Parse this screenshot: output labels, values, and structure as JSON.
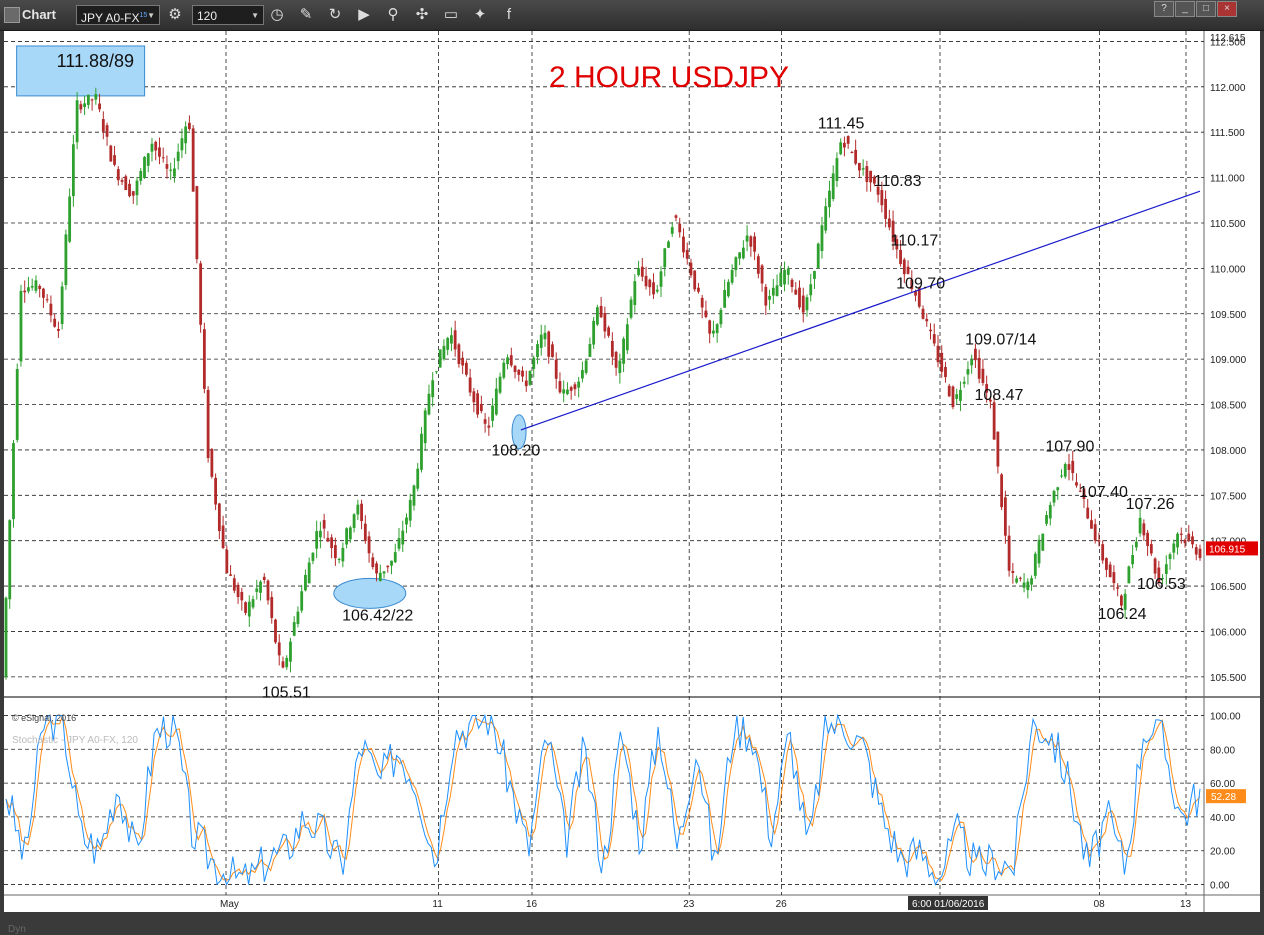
{
  "toolbar": {
    "app_title": "Chart",
    "symbol": "JPY A0-FX",
    "symbol_sup": "15",
    "interval": "120",
    "window_buttons": [
      "?",
      "_",
      "□",
      "×"
    ]
  },
  "copyright": "© eSignal, 2016",
  "stoch_label": "Stochastic - JPY A0-FX, 120",
  "dyn_label": "Dyn",
  "colors": {
    "up": "#2ea02e",
    "down": "#b22a2a",
    "title": "#e00000",
    "trend": "#1a1acc",
    "k": "#1e90ff",
    "d": "#ff8c1a",
    "price_badge": "#e00000",
    "stoch_badge": "#ff8c1a",
    "highlight": "#a8d8f8"
  },
  "chart_data": [
    {
      "type": "candlestick",
      "title": "2 HOUR USDJPY",
      "ylim": [
        105.3,
        112.615
      ],
      "yticks": [
        105.5,
        106.0,
        106.5,
        107.0,
        107.5,
        108.0,
        108.5,
        109.0,
        109.5,
        110.0,
        110.5,
        111.0,
        111.5,
        112.0,
        112.5
      ],
      "ytick_labels": [
        "105.500",
        "106.000",
        "106.500",
        "107.000",
        "107.500",
        "108.000",
        "108.500",
        "109.000",
        "109.500",
        "110.000",
        "110.500",
        "111.000",
        "111.500",
        "112.000",
        "112.500"
      ],
      "top_label": "112.615",
      "last_price": "106.915",
      "x_labels": [
        "May",
        "11",
        "16",
        "23",
        "26",
        "6:00 01/06/2016",
        "08",
        "13"
      ],
      "path_points": [
        105.5,
        109.8,
        109.8,
        109.3,
        111.8,
        111.88,
        111.1,
        110.8,
        111.4,
        111.0,
        111.7,
        108.0,
        106.7,
        106.2,
        106.6,
        105.51,
        106.4,
        107.2,
        106.8,
        107.4,
        106.6,
        106.8,
        107.5,
        108.8,
        109.3,
        108.7,
        108.2,
        109.1,
        108.7,
        109.3,
        108.6,
        108.8,
        109.6,
        108.8,
        110.0,
        109.7,
        110.6,
        109.9,
        109.2,
        109.9,
        110.4,
        109.6,
        110.0,
        109.5,
        110.5,
        111.45,
        111.1,
        110.83,
        110.17,
        109.7,
        109.1,
        108.5,
        109.07,
        108.47,
        106.6,
        106.5,
        107.3,
        107.9,
        107.4,
        106.8,
        106.3,
        107.26,
        106.53,
        107.1,
        106.9
      ],
      "annotations": [
        {
          "text": "111.88/89",
          "boxed": true,
          "x": 4.0,
          "y": 112.22
        },
        {
          "text": "105.51",
          "x": 15.0,
          "y": 105.27
        },
        {
          "text": "106.42/22",
          "x": 19.3,
          "y": 106.12
        },
        {
          "text": "108.20",
          "x": 27.3,
          "y": 107.94
        },
        {
          "text": "111.45",
          "x": 44.8,
          "y": 111.54
        },
        {
          "text": "110.83",
          "x": 47.8,
          "y": 110.91
        },
        {
          "text": "110.17",
          "x": 48.7,
          "y": 110.25
        },
        {
          "text": "109.70",
          "x": 49.0,
          "y": 109.78
        },
        {
          "text": "109.07/14",
          "x": 52.7,
          "y": 109.16
        },
        {
          "text": "108.47",
          "x": 53.2,
          "y": 108.55
        },
        {
          "text": "107.90",
          "x": 57.0,
          "y": 107.98
        },
        {
          "text": "107.40",
          "x": 58.8,
          "y": 107.48
        },
        {
          "text": "107.26",
          "x": 61.3,
          "y": 107.35
        },
        {
          "text": "106.24",
          "x": 59.8,
          "y": 106.14
        },
        {
          "text": "106.53",
          "x": 61.9,
          "y": 106.47
        }
      ],
      "highlights": [
        {
          "x": 4.0,
          "y": 112.15,
          "box": [
            111.9,
            112.45
          ]
        },
        {
          "x": 19.5,
          "y": 106.42,
          "ellipse": true
        },
        {
          "x": 27.5,
          "y": 108.2,
          "ellipse": true
        }
      ],
      "trendline": [
        [
          27.6,
          108.22
        ],
        [
          64.0,
          110.85
        ]
      ]
    },
    {
      "type": "line",
      "title": "Stochastic - JPY A0-FX, 120",
      "ylim": [
        -5,
        105
      ],
      "yticks": [
        0,
        20,
        40,
        60,
        80,
        100
      ],
      "ytick_labels": [
        "0.00",
        "20.00",
        "40.00",
        "60.00",
        "80.00",
        "100.00"
      ],
      "last_value": "52.28",
      "series": [
        {
          "name": "%K",
          "values": [
            55,
            15,
            95,
            100,
            30,
            20,
            60,
            15,
            90,
            95,
            30,
            15,
            5,
            2,
            15,
            20,
            40,
            30,
            10,
            85,
            60,
            80,
            60,
            15,
            90,
            95,
            100,
            60,
            20,
            90,
            25,
            80,
            10,
            90,
            25,
            95,
            20,
            85,
            10,
            95,
            90,
            30,
            90,
            20,
            95,
            95,
            80,
            40,
            15,
            20,
            5,
            30,
            10,
            15,
            10,
            95,
            90,
            60,
            10,
            40,
            10,
            95,
            85,
            40,
            55
          ]
        }
      ]
    }
  ]
}
